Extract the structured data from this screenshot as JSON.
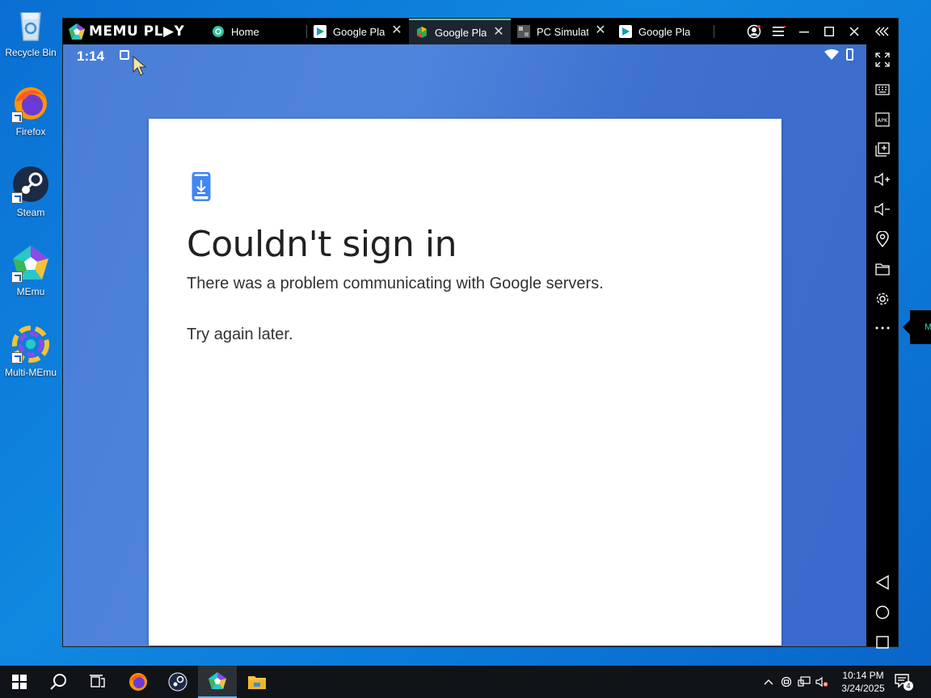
{
  "desktop": {
    "icons": [
      {
        "label": "Recycle Bin",
        "icon": "recycle-bin-icon"
      },
      {
        "label": "Firefox",
        "icon": "firefox-icon"
      },
      {
        "label": "Steam",
        "icon": "steam-icon"
      },
      {
        "label": "MEmu",
        "icon": "memu-icon"
      },
      {
        "label": "Multi-MEmu",
        "icon": "multi-memu-icon"
      }
    ]
  },
  "emulator": {
    "brand": "MEMU PL▶Y",
    "tabs": [
      {
        "label": "Home",
        "icon": "home-icon",
        "active": false,
        "closable": false
      },
      {
        "label": "Google Play",
        "icon": "google-play-icon",
        "active": false,
        "closable": true
      },
      {
        "label": "Google Play",
        "icon": "google-play-games-icon",
        "active": true,
        "closable": true
      },
      {
        "label": "PC Simulator",
        "icon": "pc-simulator-icon",
        "active": false,
        "closable": true
      },
      {
        "label": "Google Play",
        "icon": "google-play-icon",
        "active": false,
        "closable": false
      }
    ],
    "window_controls": [
      "account-icon",
      "menu-icon",
      "minimize-icon",
      "maximize-icon",
      "close-icon",
      "collapse-sidebar-icon"
    ],
    "sidebar": [
      "fullscreen-icon",
      "keyboard-mapping-icon",
      "apk-icon",
      "multi-window-icon",
      "volume-up-icon",
      "volume-down-icon",
      "location-icon",
      "folder-icon",
      "settings-icon",
      "more-icon"
    ],
    "nav_buttons": [
      "back-icon",
      "home-circle-icon",
      "recents-icon"
    ],
    "tooltip_text": "M"
  },
  "android": {
    "status": {
      "time": "1:14"
    },
    "dialog": {
      "title": "Couldn't sign in",
      "message": "There was a problem communicating with Google servers.",
      "hint": "Try again later."
    }
  },
  "taskbar": {
    "apps": [
      "start-icon",
      "search-icon",
      "task-view-icon",
      "firefox-icon",
      "steam-icon",
      "memu-icon",
      "file-explorer-icon"
    ],
    "clock_time": "10:14 PM",
    "clock_date": "3/24/2025",
    "notification_count": "4"
  },
  "colors": {
    "android_bg": "#4a7ed6",
    "accent": "#3ad3b4",
    "desktop_bg": "#0a78d8"
  }
}
